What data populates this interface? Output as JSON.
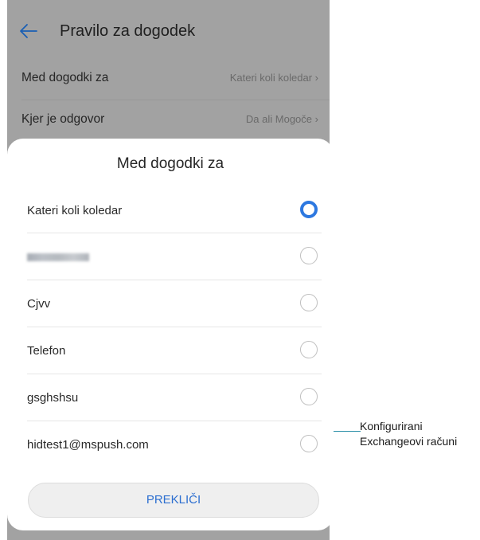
{
  "header": {
    "title": "Pravilo za dogodek"
  },
  "settings": [
    {
      "label": "Med dogodki za",
      "value": "Kateri koli koledar"
    },
    {
      "label": "Kjer je odgovor",
      "value": "Da ali Mogoče"
    }
  ],
  "dialog": {
    "title": "Med dogodki za",
    "options": [
      {
        "label": "Kateri koli koledar",
        "selected": true
      },
      {
        "label": "",
        "selected": false,
        "blurred": true
      },
      {
        "label": "Cjvv",
        "selected": false
      },
      {
        "label": "Telefon",
        "selected": false
      },
      {
        "label": "gsghshsu",
        "selected": false
      },
      {
        "label": "hidtest1@mspush.com",
        "selected": false
      }
    ],
    "cancel_label": "PREKLIČI"
  },
  "annotation": {
    "line1": "Konfigurirani",
    "line2": "Exchangeovi računi"
  },
  "colors": {
    "accent": "#2d78e0",
    "cancel_text": "#2d6fd0",
    "leader": "#2a8ea8"
  }
}
